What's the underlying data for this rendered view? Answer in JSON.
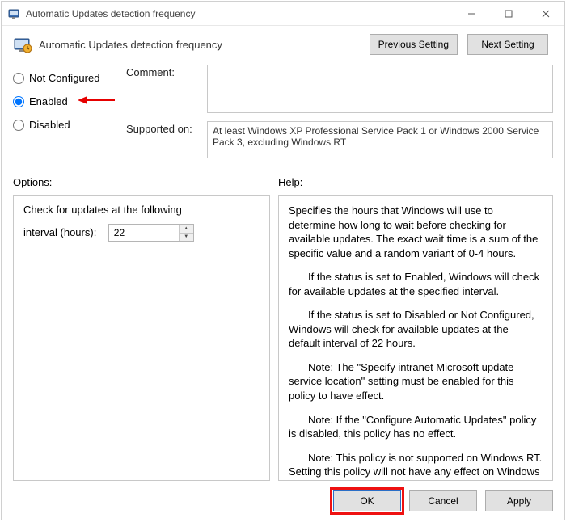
{
  "window": {
    "title": "Automatic Updates detection frequency",
    "header_title": "Automatic Updates detection frequency"
  },
  "nav": {
    "prev": "Previous Setting",
    "next": "Next Setting"
  },
  "radios": {
    "not_configured": "Not Configured",
    "enabled": "Enabled",
    "disabled": "Disabled",
    "selected": "enabled"
  },
  "fields": {
    "comment_label": "Comment:",
    "comment_value": "",
    "supported_label": "Supported on:",
    "supported_value": "At least Windows XP Professional Service Pack 1 or Windows 2000 Service Pack 3, excluding Windows RT"
  },
  "sections": {
    "options_label": "Options:",
    "help_label": "Help:"
  },
  "options": {
    "check_label": "Check for updates at the following",
    "interval_label": "interval (hours):",
    "interval_value": "22"
  },
  "help": {
    "p1": "Specifies the hours that Windows will use to determine how long to wait before checking for available updates. The exact wait time is a sum of the specific value and a random variant of 0-4 hours.",
    "p2": "If the status is set to Enabled, Windows will check for available updates at the specified interval.",
    "p3": "If the status is set to Disabled or Not Configured, Windows will check for available updates at the default interval of 22 hours.",
    "p4": "Note: The \"Specify intranet Microsoft update service location\" setting must be enabled for this policy to have effect.",
    "p5": "Note: If the \"Configure Automatic Updates\" policy is disabled, this policy has no effect.",
    "p6": "Note: This policy is not supported on Windows RT. Setting this policy will not have any effect on Windows RT PCs."
  },
  "footer": {
    "ok": "OK",
    "cancel": "Cancel",
    "apply": "Apply"
  }
}
